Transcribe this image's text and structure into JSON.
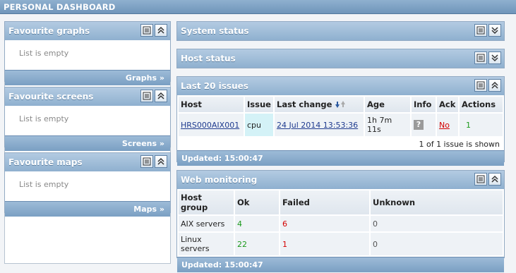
{
  "page": {
    "title": "PERSONAL DASHBOARD"
  },
  "left": {
    "widgets": [
      {
        "title": "Favourite graphs",
        "empty": "List is empty",
        "link": "Graphs »"
      },
      {
        "title": "Favourite screens",
        "empty": "List is empty",
        "link": "Screens »"
      },
      {
        "title": "Favourite maps",
        "empty": "List is empty",
        "link": "Maps »"
      }
    ]
  },
  "system_status": {
    "title": "System status"
  },
  "host_status": {
    "title": "Host status"
  },
  "issues": {
    "title": "Last 20 issues",
    "columns": [
      "Host",
      "Issue",
      "Last change",
      "Age",
      "Info",
      "Ack",
      "Actions"
    ],
    "rows": [
      {
        "host": "HRS000AIX001",
        "issue": "cpu",
        "last_change": "24 Jul 2014 13:53:36",
        "age": "1h 7m 11s",
        "info": "?",
        "ack": "No",
        "actions": "1"
      }
    ],
    "shown": "1 of 1 issue is shown",
    "updated": "Updated: 15:00:47"
  },
  "web": {
    "title": "Web monitoring",
    "columns": [
      "Host group",
      "Ok",
      "Failed",
      "Unknown"
    ],
    "rows": [
      {
        "group": "AIX servers",
        "ok": "4",
        "failed": "6",
        "unknown": "0"
      },
      {
        "group": "Linux servers",
        "ok": "22",
        "failed": "1",
        "unknown": "0"
      }
    ],
    "updated": "Updated: 15:00:47"
  },
  "icons": [
    "list-icon",
    "collapse-icon",
    "expand-icon",
    "sort-down-icon",
    "sort-up-icon"
  ],
  "colors": {
    "header": "#8fb0cf",
    "accent_red": "#d40000",
    "accent_green": "#1c9a1c"
  }
}
